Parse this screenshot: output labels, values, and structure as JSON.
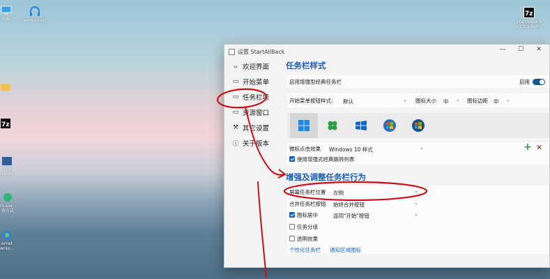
{
  "desktop": {
    "icons": [
      {
        "name": "monitor-icon",
        "label": "电脑"
      },
      {
        "name": "headphones-icon",
        "label": "wsm.music"
      },
      {
        "name": "folder-icon",
        "label": ""
      },
      {
        "name": "7zip-icon",
        "label": "7z"
      },
      {
        "name": "app-icon",
        "label": "n for\nndows"
      },
      {
        "name": "edge-icon",
        "label": "rs.exe -\n快方式"
      },
      {
        "name": "ie-icon",
        "label": "ernet\nwnlo..."
      }
    ],
    "startallback_icon": {
      "label": "StartAllBack\nv3.3.3 ReP..."
    }
  },
  "window": {
    "title": "设置 StartAllBack",
    "controls": [
      "—",
      "☐",
      "✕"
    ]
  },
  "nav": {
    "items": [
      {
        "icon": "smile-icon",
        "glyph": "ᴗ",
        "label": "欢迎界面"
      },
      {
        "icon": "start-menu-icon",
        "glyph": "▭",
        "label": "开始菜单"
      },
      {
        "icon": "taskbar-icon",
        "glyph": "▭",
        "label": "任务栏项"
      },
      {
        "icon": "explorer-icon",
        "glyph": "▭",
        "label": "资源窗口"
      },
      {
        "icon": "wrench-icon",
        "glyph": "⚒",
        "label": "其它设置"
      },
      {
        "icon": "info-icon",
        "glyph": "ⓘ",
        "label": "关于版本"
      }
    ]
  },
  "taskbar_style": {
    "heading": "任务栏样式",
    "enable_label": "启用增强型经典任务栏",
    "enable_state": "启用",
    "start_btn_label": "开始菜单按钮样式:",
    "start_btn_value": "默认",
    "icon_size_label": "图标大小",
    "icon_size_value": "中",
    "icon_margin_label": "图标边距",
    "icon_margin_value": "中",
    "click_effect_label": "微标点击效果",
    "click_effect_value": "Windows 10 样式",
    "jumplist_label": "使用增强式经典跳转列表",
    "add_glyph": "+",
    "remove_glyph": "✕",
    "swatches": [
      "windows11-logo-icon",
      "clover-icon",
      "windows10-logo-icon",
      "windows7-orb-icon",
      "windows-vista-orb-icon"
    ]
  },
  "behavior": {
    "heading": "增强及调整任务栏行为",
    "position_label": "屏幕任务栏位置",
    "position_value": "左侧",
    "combine_label": "合并任务栏按钮",
    "combine_value": "始终合并按钮",
    "center_label": "图标居中",
    "center_value": "连同\"开始\"按钮",
    "group_label": "任务分组",
    "transparent_label": "透明效果",
    "link1": "个性化任务栏",
    "link2": "通知区域图标"
  },
  "colors": {
    "accent": "#1565c0",
    "heading": "#1a5fb4",
    "annotation": "#c8101a"
  }
}
